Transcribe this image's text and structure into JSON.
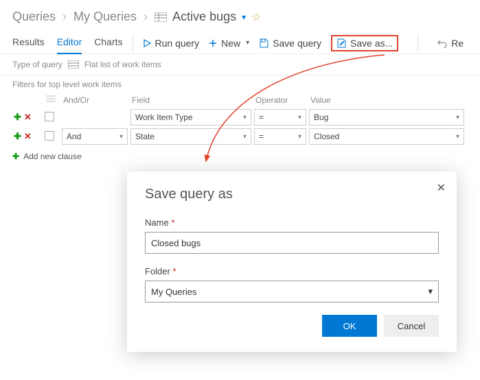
{
  "breadcrumb": {
    "root": "Queries",
    "mid": "My Queries",
    "current": "Active bugs"
  },
  "tabs": {
    "results": "Results",
    "editor": "Editor",
    "charts": "Charts"
  },
  "actions": {
    "run": "Run query",
    "new": "New",
    "save": "Save query",
    "saveas": "Save as...",
    "revert": "Re"
  },
  "typebar": {
    "label": "Type of query",
    "value": "Flat list of work items"
  },
  "filters": {
    "header": "Filters for top level work items",
    "columns": {
      "andor": "And/Or",
      "field": "Field",
      "operator": "Operator",
      "value": "Value"
    },
    "rows": [
      {
        "andor": "",
        "field": "Work Item Type",
        "operator": "=",
        "value": "Bug"
      },
      {
        "andor": "And",
        "field": "State",
        "operator": "=",
        "value": "Closed"
      }
    ],
    "addnew": "Add new clause"
  },
  "dialog": {
    "title": "Save query as",
    "name_label": "Name",
    "name_value": "Closed bugs",
    "folder_label": "Folder",
    "folder_value": "My Queries",
    "ok": "OK",
    "cancel": "Cancel"
  }
}
